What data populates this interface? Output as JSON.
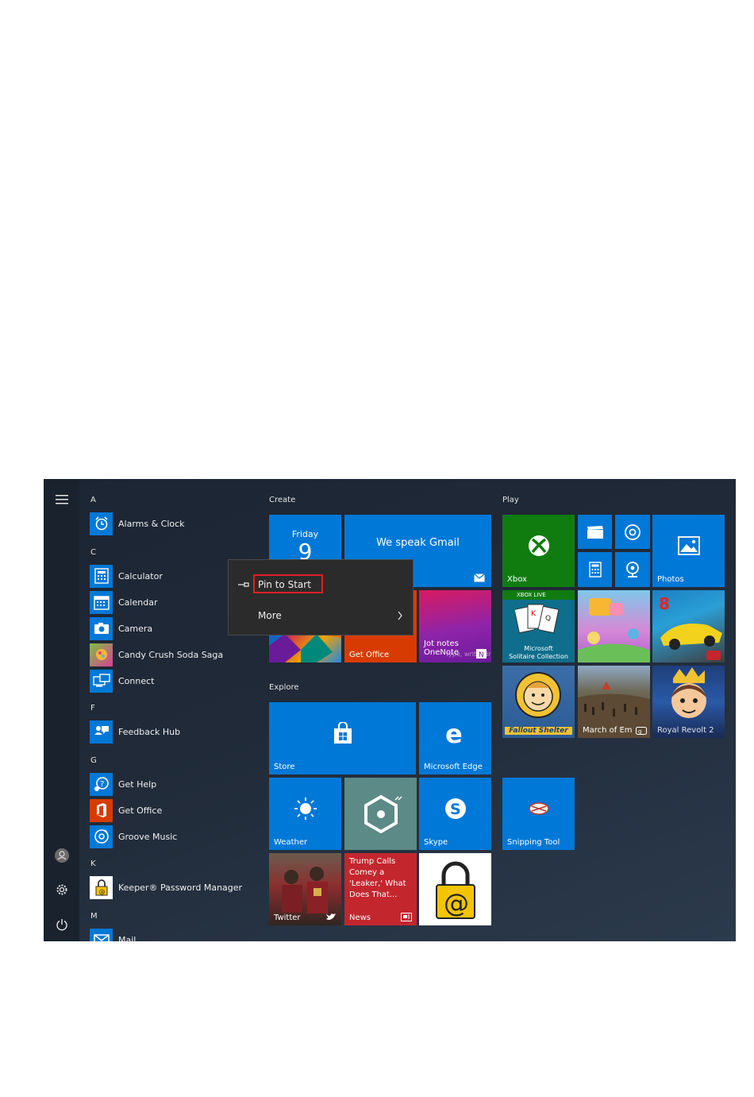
{
  "app_list": {
    "letters": [
      "A",
      "C",
      "F",
      "G",
      "K",
      "M"
    ],
    "apps": [
      {
        "label": "Alarms & Clock",
        "icon": "alarm-clock-icon"
      },
      {
        "label": "Calculator",
        "icon": "calculator-icon"
      },
      {
        "label": "Calendar",
        "icon": "calendar-icon"
      },
      {
        "label": "Camera",
        "icon": "camera-icon"
      },
      {
        "label": "Candy Crush Soda Saga",
        "icon": "candy-crush-soda-icon"
      },
      {
        "label": "Connect",
        "icon": "connect-icon"
      },
      {
        "label": "Feedback Hub",
        "icon": "feedback-hub-icon"
      },
      {
        "label": "Get Help",
        "icon": "get-help-icon"
      },
      {
        "label": "Get Office",
        "icon": "office-icon"
      },
      {
        "label": "Groove Music",
        "icon": "groove-music-icon"
      },
      {
        "label": "Keeper® Password Manager",
        "icon": "keeper-lock-icon"
      },
      {
        "label": "Mail",
        "icon": "mail-icon"
      }
    ]
  },
  "groups": {
    "create": "Create",
    "explore": "Explore",
    "play": "Play"
  },
  "tiles": {
    "calendar_day": "Friday",
    "calendar_date": "9",
    "mail_text": "We speak Gmail",
    "get_office": "Get Office",
    "onenote_line1": "Jot notes",
    "onenote_line2": "OneNote",
    "onenote_faded": "type, write, dr",
    "xbox": "Xbox",
    "photos": "Photos",
    "xbox_live": "XBOX LIVE",
    "solitaire_line1": "Microsoft",
    "solitaire_line2": "Solitaire Collection",
    "fallout": "Fallout Shelter",
    "march": "March of Em",
    "royal": "Royal Revolt 2",
    "store": "Store",
    "edge": "Microsoft Edge",
    "weather": "Weather",
    "skype": "Skype",
    "snipping": "Snipping Tool",
    "twitter": "Twitter",
    "news_headline": "Trump Calls Comey a 'Leaker,' What Does That...",
    "news": "News"
  },
  "context_menu": {
    "pin_to_start": "Pin to Start",
    "more": "More"
  },
  "colors": {
    "tile_blue": "#0078d7",
    "xbox_green": "#107c10",
    "office_orange": "#d83b01",
    "news_red": "#c4262e",
    "highlight_red": "#e31e24"
  }
}
